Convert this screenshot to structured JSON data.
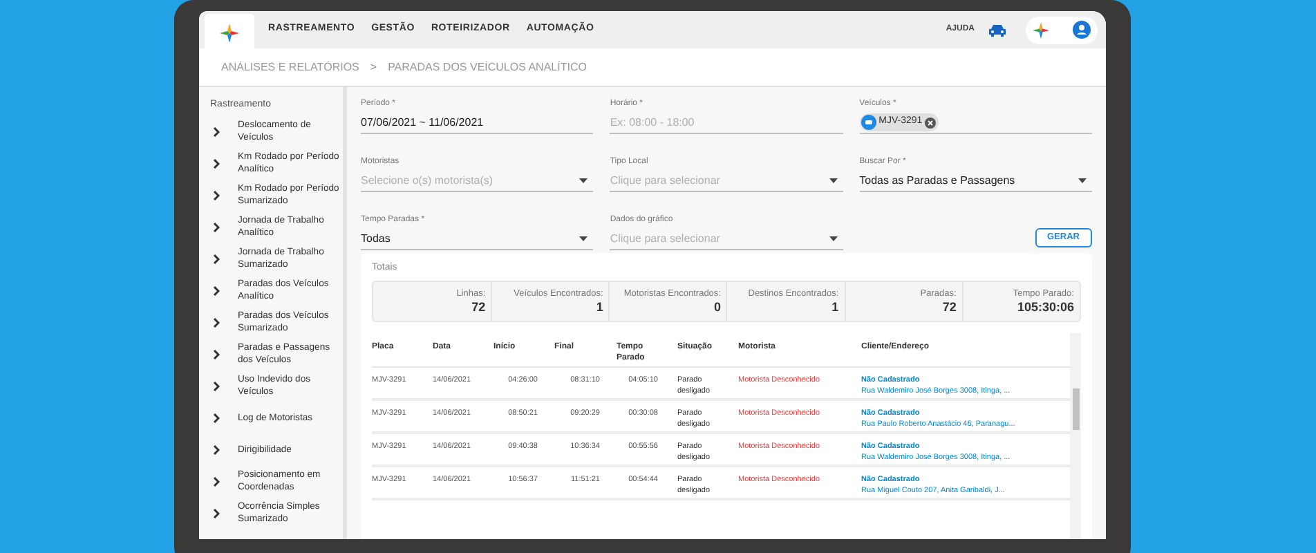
{
  "nav": {
    "items": [
      {
        "label": "RASTREAMENTO"
      },
      {
        "label": "GESTÃO"
      },
      {
        "label": "ROTEIRIZADOR"
      },
      {
        "label": "AUTOMAÇÃO"
      }
    ],
    "help": "AJUDA"
  },
  "breadcrumb": {
    "items": [
      "ANÁLISES E RELATÓRIOS",
      "PARADAS DOS VEÍCULOS ANALÍTICO"
    ],
    "separator": ">"
  },
  "sidebar": {
    "title": "Rastreamento",
    "items": [
      {
        "label": "Deslocamento de Veículos"
      },
      {
        "label": "Km Rodado por Período Analítico"
      },
      {
        "label": "Km Rodado por Período Sumarizado"
      },
      {
        "label": "Jornada de Trabalho Analítico"
      },
      {
        "label": "Jornada de Trabalho Sumarizado"
      },
      {
        "label": "Paradas dos Veículos Analítico"
      },
      {
        "label": "Paradas dos Veículos Sumarizado"
      },
      {
        "label": "Paradas e Passagens dos Veículos"
      },
      {
        "label": "Uso Indevido dos Veículos"
      },
      {
        "label": "Log de Motoristas"
      },
      {
        "label": "Dirigibilidade"
      },
      {
        "label": "Posicionamento em Coordenadas"
      },
      {
        "label": "Ocorrência Simples Sumarizado"
      }
    ]
  },
  "form": {
    "fields": [
      {
        "kind": "text",
        "label": "Período *",
        "value": "07/06/2021 ~ 11/06/2021"
      },
      {
        "kind": "text",
        "label": "Horário *",
        "placeholder": "Ex: 08:00 - 18:00"
      },
      {
        "kind": "chips",
        "label": "Veículos *",
        "chips": [
          "MJV-3291"
        ]
      },
      {
        "kind": "select",
        "label": "Motoristas",
        "placeholder": "Selecione o(s) motorista(s)"
      },
      {
        "kind": "select",
        "label": "Tipo Local",
        "placeholder": "Clique para selecionar"
      },
      {
        "kind": "select",
        "label": "Buscar Por *",
        "value": "Todas as Paradas e Passagens"
      },
      {
        "kind": "select",
        "label": "Tempo Paradas *",
        "value": "Todas"
      },
      {
        "kind": "select",
        "label": "Dados do gráfico",
        "placeholder": "Clique para selecionar"
      }
    ],
    "button": "GERAR"
  },
  "totals": {
    "title": "Totais",
    "items": [
      {
        "label": "Linhas:",
        "value": "72"
      },
      {
        "label": "Veículos Encontrados:",
        "value": "1"
      },
      {
        "label": "Motoristas Encontrados:",
        "value": "0"
      },
      {
        "label": "Destinos Encontrados:",
        "value": "1"
      },
      {
        "label": "Paradas:",
        "value": "72"
      },
      {
        "label": "Tempo Parado:",
        "value": "105:30:06"
      }
    ]
  },
  "table": {
    "columns": [
      "Placa",
      "Data",
      "Início",
      "Final",
      "Tempo Parado",
      "Situação",
      "Motorista",
      "Cliente/Endereço"
    ],
    "rows": [
      {
        "placa": "MJV-3291",
        "data": "14/06/2021",
        "inicio": "04:26:00",
        "final": "08:31:10",
        "tempo": "04:05:10",
        "situacao": "Parado desligado",
        "motorista": "Motorista Desconhecido",
        "cliente": "Não Cadastrado",
        "endereco": "Rua Waldemiro José Borges 3008, Itinga, ..."
      },
      {
        "placa": "MJV-3291",
        "data": "14/06/2021",
        "inicio": "08:50:21",
        "final": "09:20:29",
        "tempo": "00:30:08",
        "situacao": "Parado desligado",
        "motorista": "Motorista Desconhecido",
        "cliente": "Não Cadastrado",
        "endereco": "Rua Paulo Roberto Anastácio 46, Paranagu..."
      },
      {
        "placa": "MJV-3291",
        "data": "14/06/2021",
        "inicio": "09:40:38",
        "final": "10:36:34",
        "tempo": "00:55:56",
        "situacao": "Parado desligado",
        "motorista": "Motorista Desconhecido",
        "cliente": "Não Cadastrado",
        "endereco": "Rua Waldemiro José Borges 3008, Itinga, ..."
      },
      {
        "placa": "MJV-3291",
        "data": "14/06/2021",
        "inicio": "10:56:37",
        "final": "11:51:21",
        "tempo": "00:54:44",
        "situacao": "Parado desligado",
        "motorista": "Motorista Desconhecido",
        "cliente": "Não Cadastrado",
        "endereco": "Rua Miguel Couto 207, Anita Garibaldi, J..."
      }
    ]
  }
}
